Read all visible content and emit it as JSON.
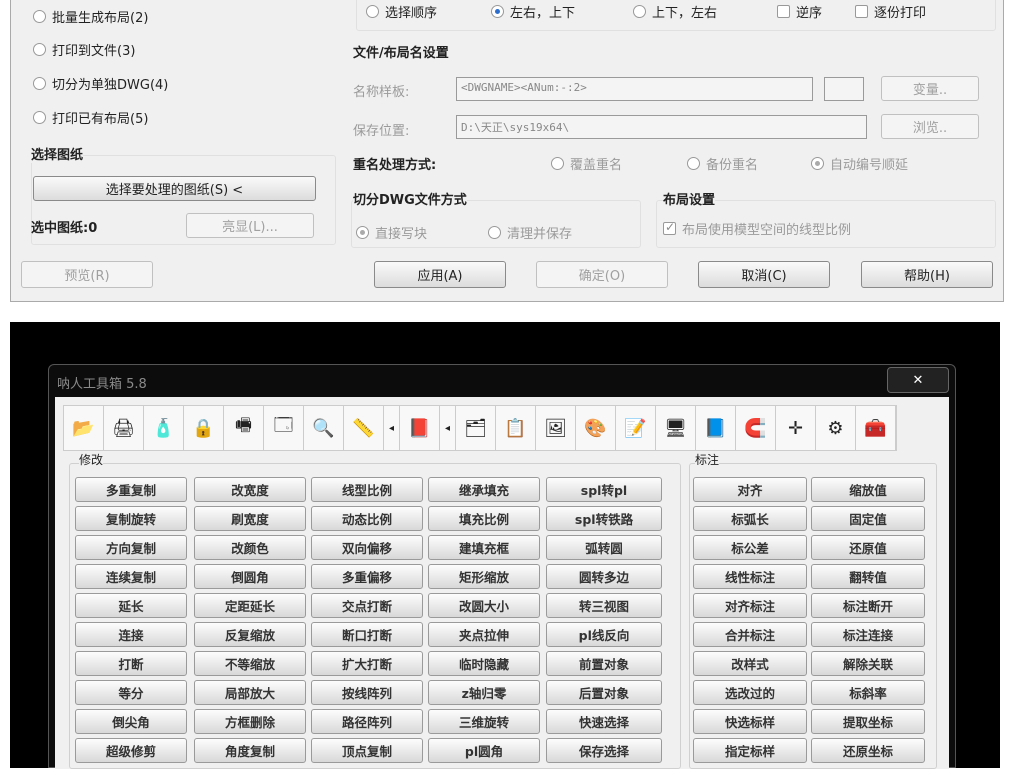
{
  "dialog": {
    "modes": [
      {
        "label": "批量生成布局(2)"
      },
      {
        "label": "打印到文件(3)"
      },
      {
        "label": "切分为单独DWG(4)"
      },
      {
        "label": "打印已有布局(5)"
      }
    ],
    "select_sheets": {
      "title": "选择图纸",
      "select_button": "选择要处理的图纸(S) <",
      "selected_count": "选中图纸:0",
      "highlight_button": "亮显(L)..."
    },
    "preview_button": "预览(R)",
    "order": {
      "options": [
        {
          "label": "选择顺序",
          "checked": false
        },
        {
          "label": "左右，上下",
          "checked": true
        },
        {
          "label": "上下，左右",
          "checked": false
        }
      ],
      "reverse": "逆序",
      "collate": "逐份打印"
    },
    "file_settings": {
      "title": "文件/布局名设置",
      "name_template_label": "名称样板:",
      "name_template_value": "<DWGNAME><ANum:-:2>",
      "variable_button": "变量..",
      "save_location_label": "保存位置:",
      "save_location_value": "D:\\天正\\sys19x64\\",
      "browse_button": "浏览.."
    },
    "rename": {
      "label": "重名处理方式:",
      "options": [
        {
          "label": "覆盖重名",
          "checked": false
        },
        {
          "label": "备份重名",
          "checked": false
        },
        {
          "label": "自动编号顺延",
          "checked": true
        }
      ]
    },
    "split": {
      "title": "切分DWG文件方式",
      "options": [
        {
          "label": "直接写块",
          "checked": true
        },
        {
          "label": "清理并保存",
          "checked": false
        }
      ]
    },
    "layout": {
      "title": "布局设置",
      "checkbox": "布局使用模型空间的线型比例",
      "checked": true
    },
    "buttons": {
      "apply": "应用(A)",
      "ok": "确定(O)",
      "cancel": "取消(C)",
      "help": "帮助(H)"
    }
  },
  "toolbox": {
    "title": "呐人工具箱 5.8",
    "close": "✕",
    "toolbar": [
      "folder-open",
      "printer",
      "paint-bucket",
      "lock",
      "scanner",
      "window",
      "search",
      "ruler",
      "arrow-left",
      "book",
      "arrow-left",
      "layers",
      "copy-block",
      "image",
      "color-grid",
      "edit-document",
      "monitor",
      "3d-box",
      "magnet",
      "crosshair",
      "gear",
      "toolbox"
    ],
    "modify": {
      "title": "修改",
      "rows": [
        [
          "多重复制",
          "改宽度",
          "线型比例",
          "继承填充",
          "spl转pl"
        ],
        [
          "复制旋转",
          "刷宽度",
          "动态比例",
          "填充比例",
          "spl转铁路"
        ],
        [
          "方向复制",
          "改颜色",
          "双向偏移",
          "建填充框",
          "弧转圆"
        ],
        [
          "连续复制",
          "倒圆角",
          "多重偏移",
          "矩形缩放",
          "圆转多边"
        ],
        [
          "延长",
          "定距延长",
          "交点打断",
          "改圆大小",
          "转三视图"
        ],
        [
          "连接",
          "反复缩放",
          "断口打断",
          "夹点拉伸",
          "pl线反向"
        ],
        [
          "打断",
          "不等缩放",
          "扩大打断",
          "临时隐藏",
          "前置对象"
        ],
        [
          "等分",
          "局部放大",
          "按线阵列",
          "z轴归零",
          "后置对象"
        ],
        [
          "倒尖角",
          "方框删除",
          "路径阵列",
          "三维旋转",
          "快速选择"
        ],
        [
          "超级修剪",
          "角度复制",
          "顶点复制",
          "pl圆角",
          "保存选择"
        ]
      ]
    },
    "dimension": {
      "title": "标注",
      "rows": [
        [
          "对齐",
          "缩放值"
        ],
        [
          "标弧长",
          "固定值"
        ],
        [
          "标公差",
          "还原值"
        ],
        [
          "线性标注",
          "翻转值"
        ],
        [
          "对齐标注",
          "标注断开"
        ],
        [
          "合并标注",
          "标注连接"
        ],
        [
          "改样式",
          "解除关联"
        ],
        [
          "选改过的",
          "标斜率"
        ],
        [
          "快选标样",
          "提取坐标"
        ],
        [
          "指定标样",
          "还原坐标"
        ]
      ]
    }
  }
}
